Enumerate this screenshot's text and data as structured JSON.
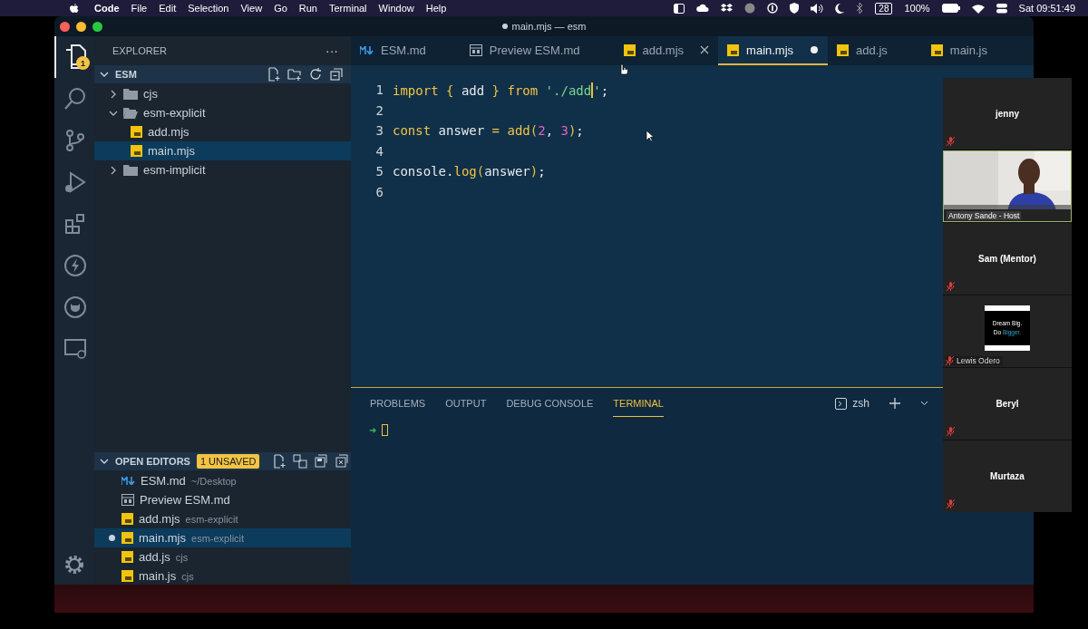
{
  "menubar": {
    "app": "Code",
    "menus": [
      "File",
      "Edit",
      "Selection",
      "View",
      "Go",
      "Run",
      "Terminal",
      "Window",
      "Help"
    ],
    "calendar_badge": "28",
    "battery": "100%",
    "clock": "Sat 09:51:49"
  },
  "window": {
    "title": "main.mjs — esm",
    "modified": true
  },
  "activity_bar": {
    "badge": "1",
    "items": [
      {
        "kind": "files",
        "selected": true
      },
      {
        "kind": "search",
        "selected": false
      },
      {
        "kind": "source-control",
        "selected": false
      },
      {
        "kind": "run",
        "selected": false
      },
      {
        "kind": "extensions",
        "selected": false
      },
      {
        "kind": "lightning",
        "selected": false
      },
      {
        "kind": "github",
        "selected": false
      },
      {
        "kind": "remote",
        "selected": false
      }
    ]
  },
  "sidebar": {
    "title": "EXPLORER",
    "more": "···",
    "root": {
      "label": "ESM",
      "expanded": true
    },
    "tree": [
      {
        "label": "cjs",
        "kind": "folder",
        "expanded": false,
        "selected": false
      },
      {
        "label": "esm-explicit",
        "kind": "folder",
        "expanded": true,
        "selected": false,
        "children": [
          {
            "label": "add.mjs",
            "kind": "js",
            "selected": false
          },
          {
            "label": "main.mjs",
            "kind": "js",
            "selected": true
          }
        ]
      },
      {
        "label": "esm-implicit",
        "kind": "folder",
        "expanded": false,
        "selected": false
      }
    ],
    "open_editors": {
      "title": "OPEN EDITORS",
      "badge": "1 UNSAVED",
      "items": [
        {
          "label": "ESM.md",
          "description": "~/Desktop",
          "kind": "markdown",
          "modified": false,
          "selected": false
        },
        {
          "label": "Preview ESM.md",
          "kind": "preview",
          "modified": false,
          "selected": false
        },
        {
          "label": "add.mjs",
          "description": "esm-explicit",
          "kind": "js",
          "modified": false,
          "selected": false
        },
        {
          "label": "main.mjs",
          "description": "esm-explicit",
          "kind": "js",
          "modified": true,
          "selected": true
        },
        {
          "label": "add.js",
          "description": "cjs",
          "kind": "js",
          "modified": false,
          "selected": false
        },
        {
          "label": "main.js",
          "description": "cjs",
          "kind": "js",
          "modified": false,
          "selected": false
        }
      ]
    }
  },
  "tabs": [
    {
      "label": "ESM.md",
      "kind": "markdown",
      "selected": false,
      "modified": false,
      "close_visible": false
    },
    {
      "label": "Preview ESM.md",
      "kind": "preview",
      "selected": false,
      "modified": false,
      "close_visible": false
    },
    {
      "label": "add.mjs",
      "kind": "js",
      "selected": false,
      "modified": false,
      "close_visible": true
    },
    {
      "label": "main.mjs",
      "kind": "js",
      "selected": true,
      "modified": true,
      "close_visible": false
    },
    {
      "label": "add.js",
      "kind": "js",
      "selected": false,
      "modified": false,
      "close_visible": false
    },
    {
      "label": "main.js",
      "kind": "js",
      "selected": false,
      "modified": false,
      "close_visible": false
    }
  ],
  "code": [
    {
      "number": "1",
      "tokens": [
        {
          "text": "import ",
          "kind": "keyword"
        },
        {
          "text": "{ ",
          "kind": "brace"
        },
        {
          "text": "add ",
          "kind": "plain"
        },
        {
          "text": "} ",
          "kind": "brace"
        },
        {
          "text": "from ",
          "kind": "keyword"
        },
        {
          "text": "'./add",
          "kind": "string",
          "caret": true
        },
        {
          "text": "'",
          "kind": "string"
        },
        {
          "text": ";",
          "kind": "plain"
        }
      ]
    },
    {
      "number": "2"
    },
    {
      "number": "3",
      "tokens": [
        {
          "text": "const ",
          "kind": "keyword"
        },
        {
          "text": "answer ",
          "kind": "plain"
        },
        {
          "text": "= ",
          "kind": "keyword"
        },
        {
          "text": "add",
          "kind": "func"
        },
        {
          "text": "(",
          "kind": "brace"
        },
        {
          "text": "2",
          "kind": "number"
        },
        {
          "text": ", ",
          "kind": "plain"
        },
        {
          "text": "3",
          "kind": "number"
        },
        {
          "text": ")",
          "kind": "brace"
        },
        {
          "text": ";",
          "kind": "plain"
        }
      ]
    },
    {
      "number": "4"
    },
    {
      "number": "5",
      "tokens": [
        {
          "text": "console",
          "kind": "plain"
        },
        {
          "text": ".",
          "kind": "plain"
        },
        {
          "text": "log",
          "kind": "func"
        },
        {
          "text": "(",
          "kind": "brace"
        },
        {
          "text": "answer",
          "kind": "plain"
        },
        {
          "text": ")",
          "kind": "brace"
        },
        {
          "text": ";",
          "kind": "plain"
        }
      ]
    },
    {
      "number": "6"
    }
  ],
  "panel": {
    "tabs": [
      {
        "label": "PROBLEMS",
        "selected": false
      },
      {
        "label": "OUTPUT",
        "selected": false
      },
      {
        "label": "DEBUG CONSOLE",
        "selected": false
      },
      {
        "label": "TERMINAL",
        "selected": true
      }
    ],
    "shell": "zsh",
    "prompt": "➜"
  },
  "meeting": {
    "tiles": [
      {
        "kind": "name",
        "name": "jenny",
        "speaking": false
      },
      {
        "kind": "video",
        "name": "Antony Sande - Host",
        "speaking": true
      },
      {
        "kind": "name",
        "name": "Sam (Mentor)",
        "speaking": false
      },
      {
        "kind": "avatar",
        "name": "Lewis Odero",
        "avatar_lines": [
          "Dream Big.",
          "Do"
        ],
        "avatar_highlight": "Bigger.",
        "speaking": false
      },
      {
        "kind": "name",
        "name": "Beryl",
        "speaking": false
      },
      {
        "kind": "name",
        "name": "Murtaza",
        "speaking": false
      }
    ]
  }
}
